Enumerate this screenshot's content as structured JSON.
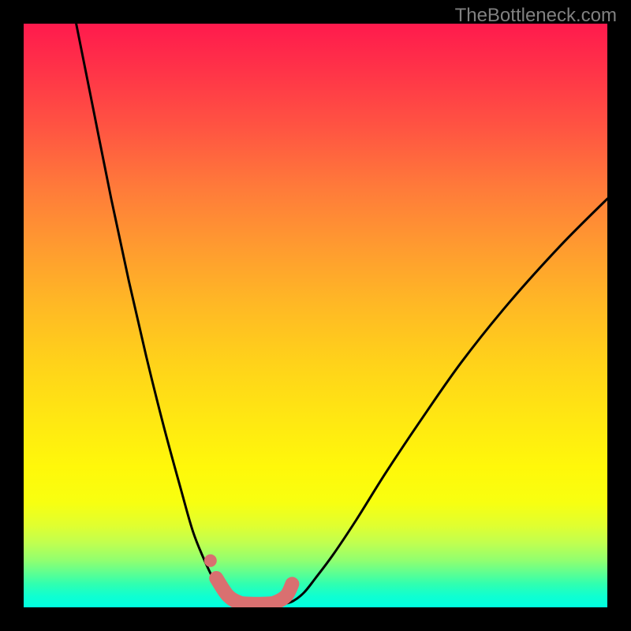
{
  "watermark": "TheBottleneck.com",
  "chart_data": {
    "type": "line",
    "title": "",
    "xlabel": "",
    "ylabel": "",
    "xlim": [
      0,
      100
    ],
    "ylim": [
      0,
      100
    ],
    "grid": false,
    "series": [
      {
        "name": "curve-left",
        "color": "#000000",
        "x": [
          9,
          12,
          15,
          18,
          21,
          24,
          27,
          29,
          31,
          33,
          35,
          36,
          37,
          38
        ],
        "y": [
          100,
          85,
          70,
          56,
          43,
          31,
          20,
          13,
          8,
          4,
          2,
          1,
          0.5,
          0.5
        ]
      },
      {
        "name": "curve-right",
        "color": "#000000",
        "x": [
          44,
          46,
          48,
          50,
          53,
          57,
          62,
          68,
          75,
          83,
          92,
          100
        ],
        "y": [
          0.5,
          1,
          2.5,
          5,
          9,
          15,
          23,
          32,
          42,
          52,
          62,
          70
        ]
      },
      {
        "name": "highlight-segment",
        "color": "#d97070",
        "x": [
          33,
          35,
          37,
          39,
          41,
          43,
          45,
          46
        ],
        "y": [
          5,
          2,
          0.8,
          0.6,
          0.6,
          0.8,
          2,
          4
        ]
      },
      {
        "name": "highlight-dot",
        "color": "#d97070",
        "type": "scatter",
        "x": [
          32
        ],
        "y": [
          8
        ]
      }
    ],
    "gradient_background": {
      "top_color": "#ff1a4d",
      "bottom_color": "#00ffe0",
      "description": "vertical red-orange-yellow-green gradient"
    }
  }
}
